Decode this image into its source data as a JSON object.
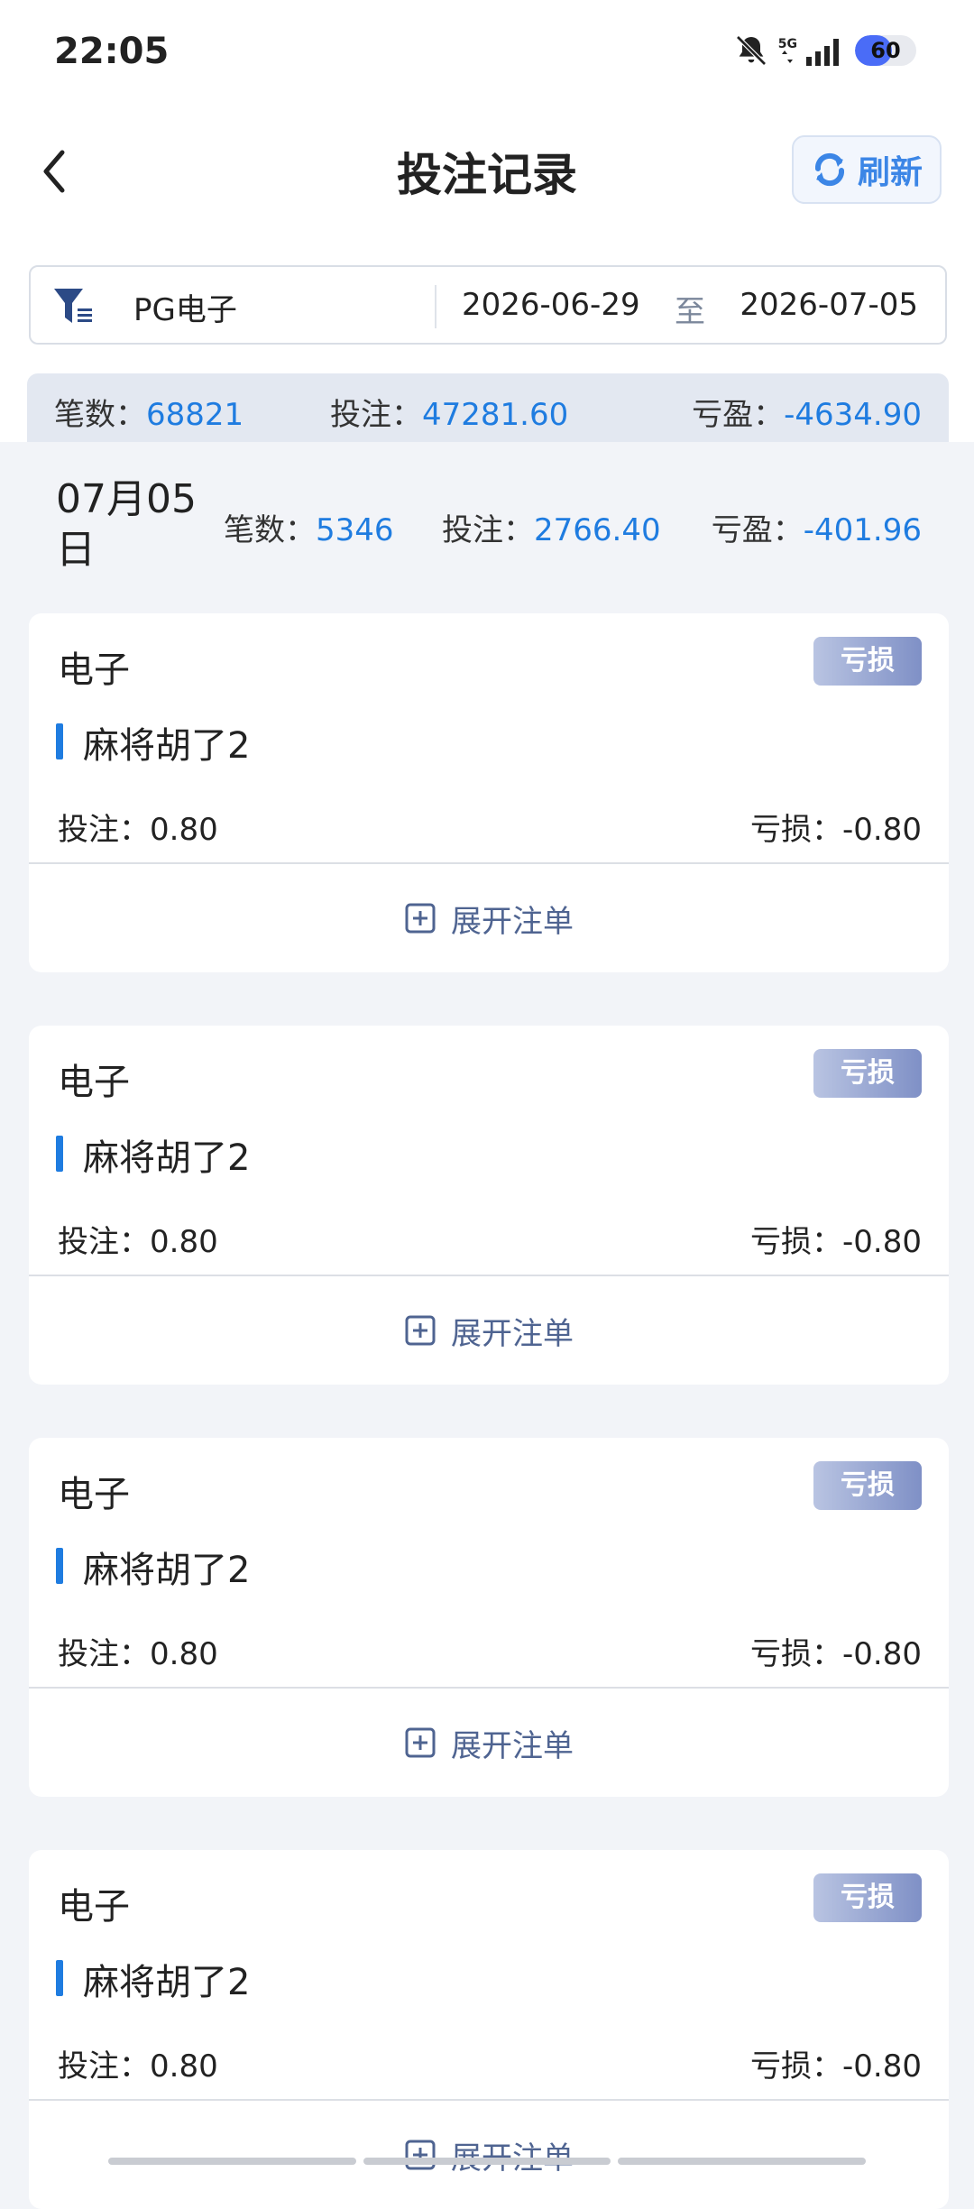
{
  "status": {
    "time": "22:05",
    "network": "5G",
    "battery": 60
  },
  "header": {
    "title": "投注记录",
    "refresh_label": "刷新"
  },
  "filter": {
    "game": "PG电子",
    "start_date": "2026-06-29",
    "separator": "至",
    "end_date": "2026-07-05"
  },
  "summary": {
    "count_label": "笔数：",
    "count_value": "68821",
    "bet_label": "投注：",
    "bet_value": "47281.60",
    "pl_label": "亏盈：",
    "pl_value": "-4634.90"
  },
  "day": {
    "date": "07月05日",
    "count_label": "笔数：",
    "count_value": "5346",
    "bet_label": "投注：",
    "bet_value": "2766.40",
    "pl_label": "亏盈：",
    "pl_value": "-401.96"
  },
  "records": [
    {
      "category": "电子",
      "badge": "亏损",
      "game": "麻将胡了2",
      "bet": "投注：0.80",
      "loss": "亏损：-0.80",
      "expand": "展开注单"
    },
    {
      "category": "电子",
      "badge": "亏损",
      "game": "麻将胡了2",
      "bet": "投注：0.80",
      "loss": "亏损：-0.80",
      "expand": "展开注单"
    },
    {
      "category": "电子",
      "badge": "亏损",
      "game": "麻将胡了2",
      "bet": "投注：0.80",
      "loss": "亏损：-0.80",
      "expand": "展开注单"
    },
    {
      "category": "电子",
      "badge": "亏损",
      "game": "麻将胡了2",
      "bet": "投注：0.80",
      "loss": "亏损：-0.80",
      "expand": "展开注单"
    }
  ],
  "colors": {
    "accent": "#1f7ce0",
    "badge_start": "#b9c4e2",
    "badge_end": "#7f90c6",
    "expand_text": "#4f6491"
  }
}
